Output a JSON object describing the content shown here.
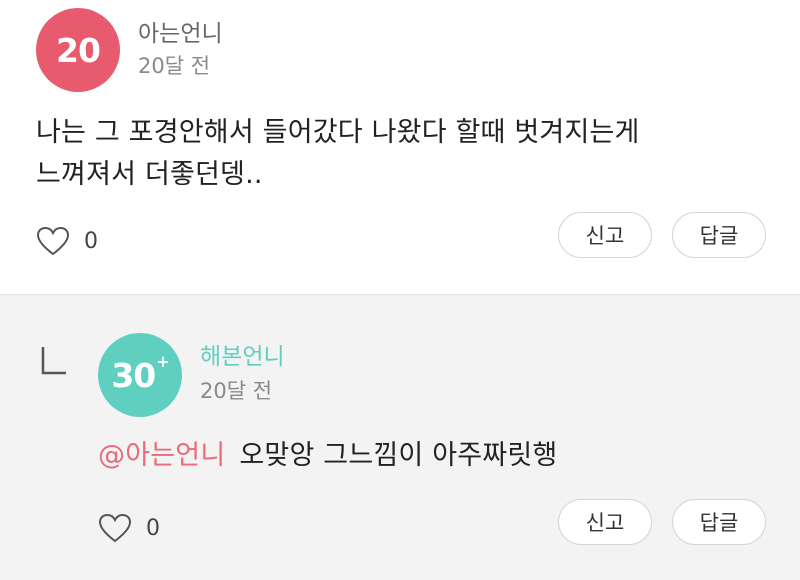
{
  "comments": {
    "main": {
      "avatar": {
        "label": "20",
        "color": "#e85a6e"
      },
      "author": "아는언니",
      "time": "20달 전",
      "text": "나는 그 포경안해서 들어갔다 나왔다 할때 벗겨지는게\n느껴져서 더좋던뎅..",
      "likes": "0",
      "report_label": "신고",
      "reply_label": "답글"
    },
    "reply": {
      "avatar": {
        "label": "30",
        "badge": "+",
        "color": "#5fd0c0"
      },
      "author": "해본언니",
      "author_color": "#5fd0c0",
      "time": "20달 전",
      "mention": "@아는언니",
      "text": "오맞앙 그느낌이 아주짜릿행",
      "likes": "0",
      "report_label": "신고",
      "reply_label": "답글"
    }
  },
  "icons": {
    "like": "heart-outline-icon",
    "reply_indicator": "reply-corner-icon"
  },
  "colors": {
    "mention": "#e96a78",
    "reply_background": "#f3f3f3"
  }
}
